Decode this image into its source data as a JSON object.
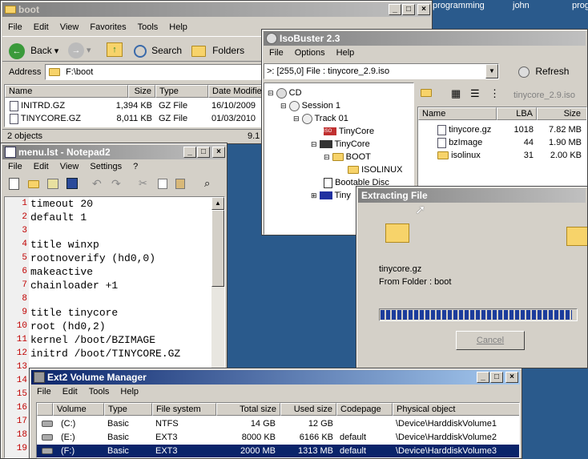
{
  "desktop": {
    "users": [
      "programming",
      "john",
      "prog"
    ]
  },
  "explorer": {
    "title": "boot",
    "menu": [
      "File",
      "Edit",
      "View",
      "Favorites",
      "Tools",
      "Help"
    ],
    "toolbar": {
      "back": "Back",
      "search": "Search",
      "folders": "Folders"
    },
    "address_label": "Address",
    "address_value": "F:\\boot",
    "columns": [
      "Name",
      "Size",
      "Type",
      "Date Modifie"
    ],
    "files": [
      {
        "name": "INITRD.GZ",
        "size": "1,394 KB",
        "type": "GZ File",
        "date": "16/10/2009"
      },
      {
        "name": "TINYCORE.GZ",
        "size": "8,011 KB",
        "type": "GZ File",
        "date": "01/03/2010"
      }
    ],
    "status": "2 objects",
    "status_size": "9.1"
  },
  "notepad": {
    "title": "menu.lst - Notepad2",
    "menu": [
      "File",
      "Edit",
      "View",
      "Settings",
      "?"
    ],
    "lines": [
      "timeout 20",
      "default 1",
      "",
      "title winxp",
      "rootnoverify (hd0,0)",
      "makeactive",
      "chainloader +1",
      "",
      "title tinycore",
      "root (hd0,2)",
      "kernel /boot/BZIMAGE",
      "initrd /boot/TINYCORE.GZ",
      "",
      "",
      "",
      "",
      "",
      "",
      ""
    ],
    "line_numbers": [
      "1",
      "2",
      "3",
      "4",
      "5",
      "6",
      "7",
      "8",
      "9",
      "10",
      "11",
      "12",
      "13",
      "14",
      "15",
      "16",
      "17",
      "18",
      "19"
    ]
  },
  "isobuster": {
    "title": "IsoBuster 2.3",
    "menu": [
      "File",
      "Options",
      "Help"
    ],
    "device": ">: [255,0]  File :    tinycore_2.9.iso",
    "refresh": "Refresh",
    "path_label": "tinycore_2.9.iso",
    "tree": [
      "CD",
      "Session 1",
      "Track 01",
      "TinyCore",
      "TinyCore",
      "BOOT",
      "ISOLINUX",
      "Bootable Disc",
      "Tiny"
    ],
    "columns": [
      "Name",
      "LBA",
      "Size"
    ],
    "files": [
      {
        "name": "tinycore.gz",
        "lba": "1018",
        "size": "7.82 MB"
      },
      {
        "name": "bzImage",
        "lba": "44",
        "size": "1.90 MB"
      },
      {
        "name": "isolinux",
        "lba": "31",
        "size": "2.00 KB"
      }
    ],
    "progress_fraction": 0.98
  },
  "extract": {
    "title": "Extracting File",
    "file": "tinycore.gz",
    "from": "From Folder : boot",
    "cancel": "Cancel",
    "progress_fraction": 0.98
  },
  "ext2": {
    "title": "Ext2 Volume Manager",
    "menu": [
      "File",
      "Edit",
      "Tools",
      "Help"
    ],
    "columns": [
      "Volume",
      "Type",
      "File system",
      "Total size",
      "Used size",
      "Codepage",
      "Physical object"
    ],
    "rows": [
      {
        "volume": "(C:)",
        "type": "Basic",
        "fs": "NTFS",
        "total": "14 GB",
        "used": "12 GB",
        "cp": "",
        "phys": "\\Device\\HarddiskVolume1"
      },
      {
        "volume": "(E:)",
        "type": "Basic",
        "fs": "EXT3",
        "total": "8000 KB",
        "used": "6166 KB",
        "cp": "default",
        "phys": "\\Device\\HarddiskVolume2"
      },
      {
        "volume": "(F:)",
        "type": "Basic",
        "fs": "EXT3",
        "total": "2000 MB",
        "used": "1313 MB",
        "cp": "default",
        "phys": "\\Device\\HarddiskVolume3"
      }
    ]
  },
  "colors": {
    "active_title": "#0a246a",
    "selection": "#0a246a",
    "line_number": "#c00000",
    "progress": "#1c3c9c"
  }
}
